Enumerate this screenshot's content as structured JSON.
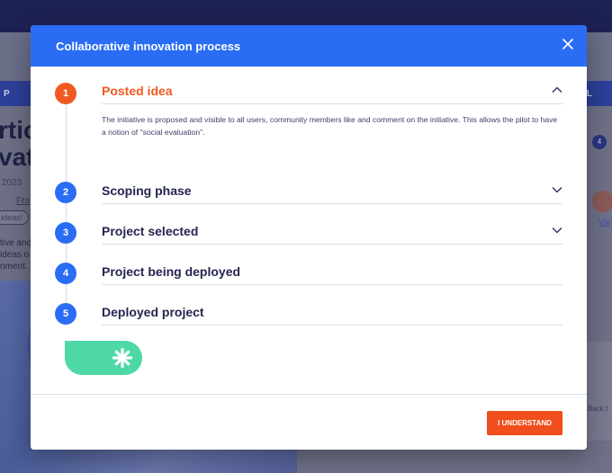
{
  "background": {
    "nav_left": "P",
    "nav_right": "L",
    "title_line1": "rtic",
    "title_line2": "vati",
    "date": "2023",
    "author_fragment": "Fra",
    "tag": "ideas!",
    "text_line1": "tive and",
    "text_line2": "ideas o",
    "text_line3": "nment. I",
    "badge": "4",
    "link": "Vie",
    "back_label": "Back t"
  },
  "modal": {
    "title": "Collaborative innovation process",
    "close_icon": "close-icon",
    "steps": [
      {
        "number": "1",
        "title": "Posted idea",
        "active": true,
        "expanded": true,
        "chevron": "chevron-up-icon",
        "description": "The initiative is proposed and visible to all users, community members like and comment on the initiative. This allows the pilot to have a notion of \"social evaluation\"."
      },
      {
        "number": "2",
        "title": "Scoping phase",
        "active": false,
        "expanded": false,
        "chevron": "chevron-down-icon"
      },
      {
        "number": "3",
        "title": "Project selected",
        "active": false,
        "expanded": false,
        "chevron": "chevron-down-icon"
      },
      {
        "number": "4",
        "title": "Project being deployed",
        "active": false,
        "expanded": false
      },
      {
        "number": "5",
        "title": "Deployed project",
        "active": false,
        "expanded": false
      }
    ],
    "decoration_icon": "asterisk-icon",
    "button_label": "I UNDERSTAND"
  },
  "colors": {
    "primary": "#2a6df4",
    "accent": "#f05a22",
    "dark_text": "#23264f",
    "pill_green": "#4ed8a6"
  }
}
